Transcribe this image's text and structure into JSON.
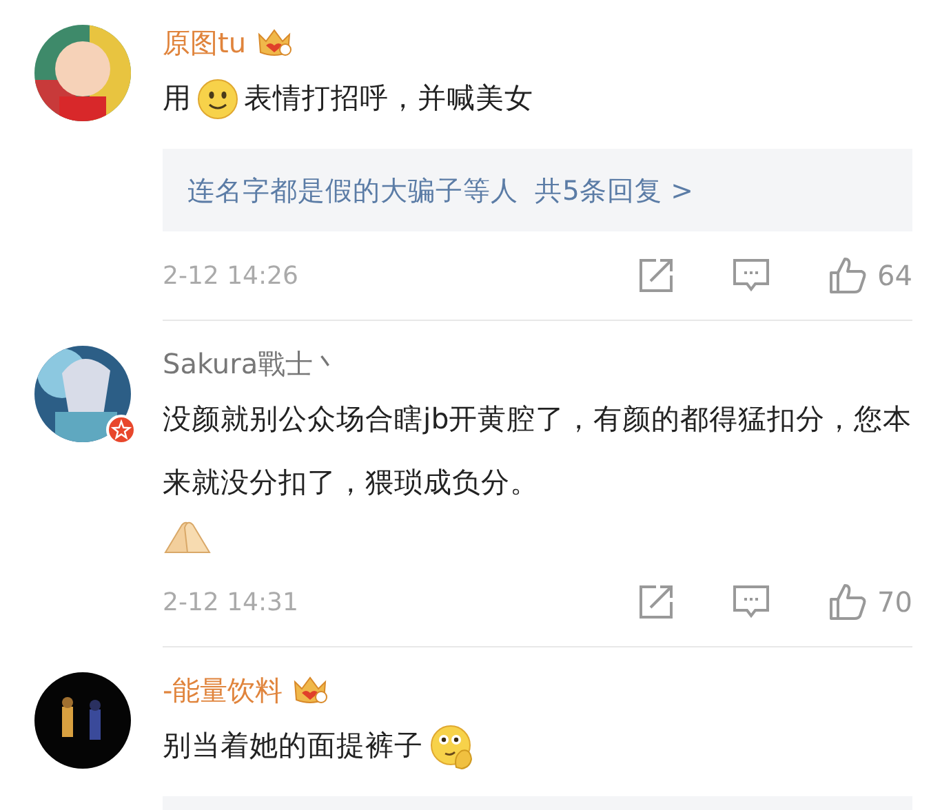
{
  "comments": [
    {
      "username": "原图tu",
      "vip": true,
      "verified": false,
      "avatar": {
        "kind": "picture"
      },
      "body": [
        {
          "kind": "text",
          "text": "用"
        },
        {
          "kind": "smile"
        },
        {
          "kind": "text",
          "text": "表情打招呼，并喊美女"
        }
      ],
      "replies": {
        "kind": "full",
        "names": "连名字都是假的大骗子等人",
        "count": "共5条回复 >"
      },
      "time": "2-12 14:26",
      "likes": "64"
    },
    {
      "username": "Sakura戰士丶",
      "vip": false,
      "verified": true,
      "avatar": {
        "kind": "picture"
      },
      "body": [
        {
          "kind": "text",
          "text": "没颜就别公众场合瞎jb开黄腔了，有颜的都得猛扣分，您本来就没分扣了，猥琐成负分。"
        },
        {
          "kind": "hands"
        }
      ],
      "time": "2-12 14:31",
      "likes": "70"
    },
    {
      "username": "-能量饮料",
      "vip": true,
      "verified": false,
      "avatar": {
        "kind": "picture"
      },
      "body": [
        {
          "kind": "text",
          "text": "别当着她的面提裤子"
        },
        {
          "kind": "thinking"
        }
      ],
      "replies": {
        "kind": "partial"
      }
    }
  ]
}
